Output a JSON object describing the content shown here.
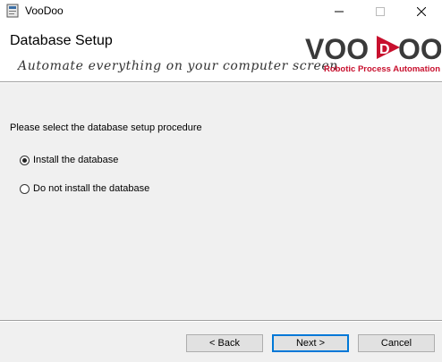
{
  "window": {
    "title": "VooDoo"
  },
  "header": {
    "title": "Database Setup",
    "tagline": "Automate everything on your computer screen",
    "logo": {
      "text_left": "VOO",
      "text_badge": "D",
      "text_right": "OO",
      "subtitle": "Robotic Process Automation"
    }
  },
  "main": {
    "prompt": "Please select the database setup procedure",
    "options": [
      {
        "label": "Install the database",
        "selected": true
      },
      {
        "label": "Do not install the database",
        "selected": false
      }
    ]
  },
  "footer": {
    "back_label": "< Back",
    "next_label": "Next >",
    "cancel_label": "Cancel"
  },
  "colors": {
    "accent": "#0078d7",
    "logo_red": "#c8102e",
    "logo_dark": "#3a3a3a"
  }
}
